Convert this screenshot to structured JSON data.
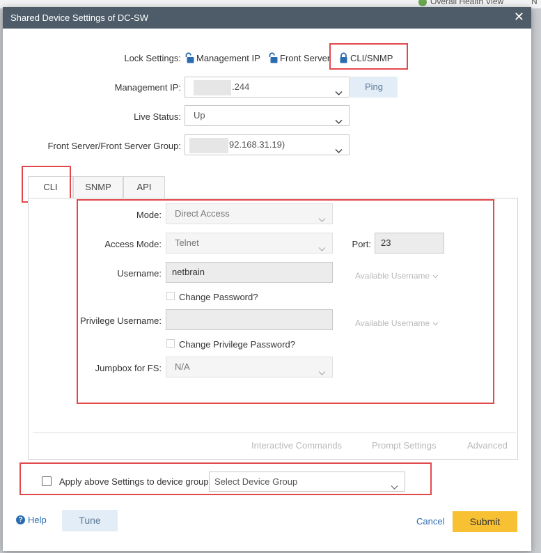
{
  "background": {
    "health_view_label": "Overall Health View",
    "right_edge_text": "N"
  },
  "dialog": {
    "title": "Shared Device Settings of DC-SW",
    "close_glyph": "✕"
  },
  "lock_settings": {
    "label": "Lock Settings:",
    "items": [
      {
        "label": "Management IP",
        "state": "unlocked"
      },
      {
        "label": "Front Server",
        "state": "unlocked"
      },
      {
        "label": "CLI/SNMP",
        "state": "locked"
      }
    ]
  },
  "management_ip": {
    "label": "Management IP:",
    "value": ".244",
    "ping_label": "Ping"
  },
  "live_status": {
    "label": "Live Status:",
    "value": "Up"
  },
  "front_server": {
    "label": "Front Server/Front Server Group:",
    "value": "92.168.31.19)"
  },
  "tabs": [
    {
      "label": "CLI",
      "active": true
    },
    {
      "label": "SNMP",
      "active": false
    },
    {
      "label": "API",
      "active": false
    }
  ],
  "cli": {
    "mode": {
      "label": "Mode:",
      "value": "Direct Access"
    },
    "access_mode": {
      "label": "Access Mode:",
      "value": "Telnet"
    },
    "port": {
      "label": "Port:",
      "value": "23"
    },
    "username": {
      "label": "Username:",
      "value": "netbrain",
      "available": "Available Username"
    },
    "change_password": {
      "label": "Change Password?"
    },
    "privilege_username": {
      "label": "Privilege Username:",
      "value": "",
      "available": "Available Username"
    },
    "change_privilege_password": {
      "label": "Change Privilege Password?"
    },
    "jumpbox": {
      "label": "Jumpbox for FS:",
      "value": "N/A"
    }
  },
  "panel_links": [
    "Interactive Commands",
    "Prompt Settings",
    "Advanced"
  ],
  "apply_group": {
    "label": "Apply above Settings to device group:",
    "placeholder": "Select Device Group"
  },
  "footer": {
    "help": "Help",
    "tune": "Tune",
    "cancel": "Cancel",
    "submit": "Submit"
  },
  "colors": {
    "titlebar": "#4d5c68",
    "highlight": "#e2474b",
    "submit": "#f8c033",
    "link": "#2b6cb0",
    "lock_icon": "#2b6cb0"
  }
}
